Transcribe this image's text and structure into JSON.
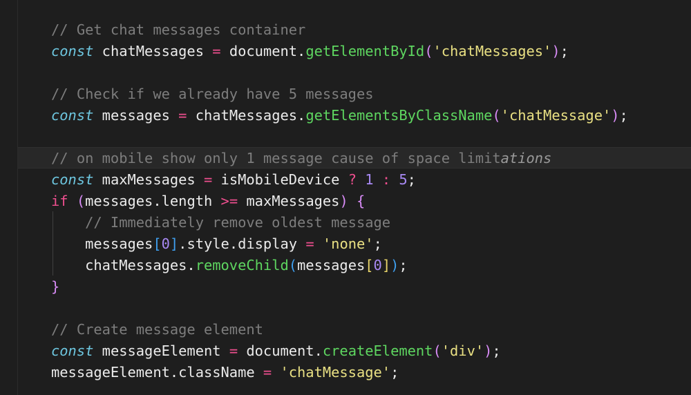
{
  "editor": {
    "theme": {
      "background": "#1e1e1e",
      "comment": "#7d7d7d",
      "keyword": "#6ec7e0",
      "operator": "#ef4f8f",
      "function": "#5ed660",
      "string": "#e9e083",
      "number": "#a98af5"
    },
    "lines": [
      [
        {
          "t": "// Get chat messages container",
          "c": "cmt"
        }
      ],
      [
        {
          "t": "const",
          "c": "kw"
        },
        {
          "t": " chatMessages ",
          "c": "pl"
        },
        {
          "t": "=",
          "c": "op"
        },
        {
          "t": " document.",
          "c": "pl"
        },
        {
          "t": "getElementById",
          "c": "fn"
        },
        {
          "t": "(",
          "c": "p1"
        },
        {
          "t": "'chatMessages'",
          "c": "str"
        },
        {
          "t": ")",
          "c": "p1"
        },
        {
          "t": ";",
          "c": "pl"
        }
      ],
      [],
      [
        {
          "t": "// Check if we already have 5 messages",
          "c": "cmt"
        }
      ],
      [
        {
          "t": "const",
          "c": "kw"
        },
        {
          "t": " messages ",
          "c": "pl"
        },
        {
          "t": "=",
          "c": "op"
        },
        {
          "t": " chatMessages.",
          "c": "pl"
        },
        {
          "t": "getElementsByClassName",
          "c": "fn"
        },
        {
          "t": "(",
          "c": "p1"
        },
        {
          "t": "'chatMessage'",
          "c": "str"
        },
        {
          "t": ")",
          "c": "p1"
        },
        {
          "t": ";",
          "c": "pl"
        }
      ],
      [],
      [
        {
          "t": "// on mobile show only 1 message cause of space limit",
          "c": "cmt"
        },
        {
          "t": "ations",
          "c": "cmt-it"
        }
      ],
      [
        {
          "t": "const",
          "c": "kw"
        },
        {
          "t": " maxMessages ",
          "c": "pl"
        },
        {
          "t": "=",
          "c": "op"
        },
        {
          "t": " isMobileDevice ",
          "c": "pl"
        },
        {
          "t": "?",
          "c": "op"
        },
        {
          "t": " ",
          "c": "pl"
        },
        {
          "t": "1",
          "c": "num"
        },
        {
          "t": " ",
          "c": "pl"
        },
        {
          "t": ":",
          "c": "op"
        },
        {
          "t": " ",
          "c": "pl"
        },
        {
          "t": "5",
          "c": "num"
        },
        {
          "t": ";",
          "c": "pl"
        }
      ],
      [
        {
          "t": "if",
          "c": "kw2"
        },
        {
          "t": " ",
          "c": "pl"
        },
        {
          "t": "(",
          "c": "p1"
        },
        {
          "t": "messages.length ",
          "c": "pl"
        },
        {
          "t": ">=",
          "c": "op"
        },
        {
          "t": " maxMessages",
          "c": "pl"
        },
        {
          "t": ")",
          "c": "p1"
        },
        {
          "t": " ",
          "c": "pl"
        },
        {
          "t": "{",
          "c": "p1"
        }
      ],
      [
        {
          "t": "    // Immediately remove oldest message",
          "c": "cmt"
        }
      ],
      [
        {
          "t": "    messages",
          "c": "pl"
        },
        {
          "t": "[",
          "c": "p2"
        },
        {
          "t": "0",
          "c": "num"
        },
        {
          "t": "]",
          "c": "p2"
        },
        {
          "t": ".style.display ",
          "c": "pl"
        },
        {
          "t": "=",
          "c": "op"
        },
        {
          "t": " ",
          "c": "pl"
        },
        {
          "t": "'none'",
          "c": "str"
        },
        {
          "t": ";",
          "c": "pl"
        }
      ],
      [
        {
          "t": "    chatMessages.",
          "c": "pl"
        },
        {
          "t": "removeChild",
          "c": "fn"
        },
        {
          "t": "(",
          "c": "p2"
        },
        {
          "t": "messages",
          "c": "pl"
        },
        {
          "t": "[",
          "c": "p3"
        },
        {
          "t": "0",
          "c": "num"
        },
        {
          "t": "]",
          "c": "p3"
        },
        {
          "t": ")",
          "c": "p2"
        },
        {
          "t": ";",
          "c": "pl"
        }
      ],
      [
        {
          "t": "}",
          "c": "p1"
        }
      ],
      [],
      [
        {
          "t": "// Create message element",
          "c": "cmt"
        }
      ],
      [
        {
          "t": "const",
          "c": "kw"
        },
        {
          "t": " messageElement ",
          "c": "pl"
        },
        {
          "t": "=",
          "c": "op"
        },
        {
          "t": " document.",
          "c": "pl"
        },
        {
          "t": "createElement",
          "c": "fn"
        },
        {
          "t": "(",
          "c": "p1"
        },
        {
          "t": "'div'",
          "c": "str"
        },
        {
          "t": ")",
          "c": "p1"
        },
        {
          "t": ";",
          "c": "pl"
        }
      ],
      [
        {
          "t": "messageElement.className ",
          "c": "pl"
        },
        {
          "t": "=",
          "c": "op"
        },
        {
          "t": " ",
          "c": "pl"
        },
        {
          "t": "'chatMessage'",
          "c": "str"
        },
        {
          "t": ";",
          "c": "pl"
        }
      ]
    ]
  }
}
